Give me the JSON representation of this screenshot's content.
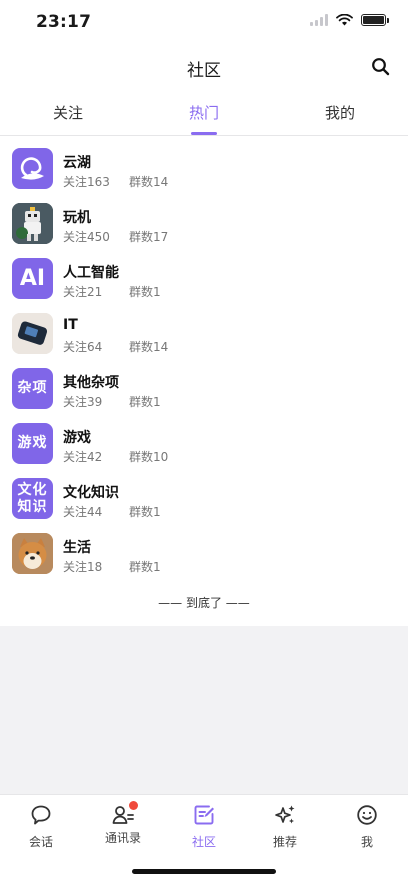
{
  "status_bar": {
    "time": "23:17"
  },
  "header": {
    "title": "社区",
    "search_icon": "search-icon"
  },
  "tabs": [
    {
      "label": "关注",
      "active": false
    },
    {
      "label": "热门",
      "active": true
    },
    {
      "label": "我的",
      "active": false
    }
  ],
  "communities": [
    {
      "name": "云湖",
      "follow": "关注163",
      "groups": "群数14",
      "icon": "yunhu-logo-icon"
    },
    {
      "name": "玩机",
      "follow": "关注450",
      "groups": "群数17",
      "icon": "robot-photo-icon"
    },
    {
      "name": "人工智能",
      "follow": "关注21",
      "groups": "群数1",
      "icon_text": "AI"
    },
    {
      "name": "IT",
      "follow": "关注64",
      "groups": "群数14",
      "icon": "device-photo-icon"
    },
    {
      "name": "其他杂项",
      "follow": "关注39",
      "groups": "群数1",
      "icon_text": "杂项"
    },
    {
      "name": "游戏",
      "follow": "关注42",
      "groups": "群数10",
      "icon_text": "游戏"
    },
    {
      "name": "文化知识",
      "follow": "关注44",
      "groups": "群数1",
      "icon_text_line1": "文化",
      "icon_text_line2": "知识"
    },
    {
      "name": "生活",
      "follow": "关注18",
      "groups": "群数1",
      "icon": "shiba-dog-photo-icon"
    }
  ],
  "footer_note": "—— 到底了 ——",
  "tabbar": [
    {
      "label": "会话",
      "icon": "chat-bubble-icon"
    },
    {
      "label": "通讯录",
      "icon": "contacts-icon",
      "badge": true
    },
    {
      "label": "社区",
      "icon": "community-edit-icon",
      "active": true
    },
    {
      "label": "推荐",
      "icon": "sparkle-icon"
    },
    {
      "label": "我",
      "icon": "smiley-icon"
    }
  ],
  "colors": {
    "accent": "#8a6cf0",
    "badge": "#f04a3c",
    "icon_purple": "#8066e8"
  }
}
